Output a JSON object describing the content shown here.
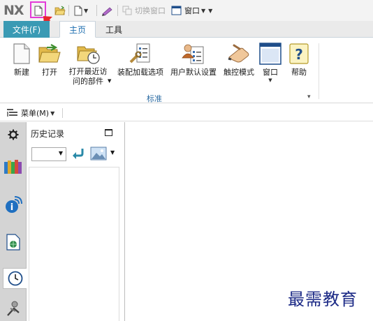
{
  "app": {
    "logo": "NX"
  },
  "quick_access": {
    "switch_window_label": "切换窗口",
    "window_label": "窗口"
  },
  "tabs": [
    {
      "label": "文件(F)",
      "active": false
    },
    {
      "label": "主页",
      "active": true
    },
    {
      "label": "工具",
      "active": false
    }
  ],
  "ribbon": {
    "buttons": [
      {
        "label": "新建",
        "icon": "new-document-icon"
      },
      {
        "label": "打开",
        "icon": "open-folder-icon"
      },
      {
        "label": "打开最近访\n问的部件",
        "icon": "recent-parts-icon",
        "dropdown": true
      },
      {
        "label": "装配加载选项",
        "icon": "assembly-load-options-icon"
      },
      {
        "label": "用户默认设置",
        "icon": "user-defaults-icon"
      },
      {
        "label": "触控模式",
        "icon": "touch-mode-icon"
      },
      {
        "label": "窗口",
        "icon": "window-icon",
        "dropdown": true
      },
      {
        "label": "帮助",
        "icon": "help-icon"
      }
    ],
    "group_label": "标准"
  },
  "menubar": {
    "menu_label": "菜单(M)"
  },
  "panel": {
    "title": "历史记录"
  },
  "watermark": "最需教育",
  "colors": {
    "file_tab": "#3a9ab4",
    "active_tab_text": "#1f6fb0",
    "highlight_box": "#e33cd8",
    "arrow": "#e8262b",
    "watermark": "#1c2a86"
  }
}
